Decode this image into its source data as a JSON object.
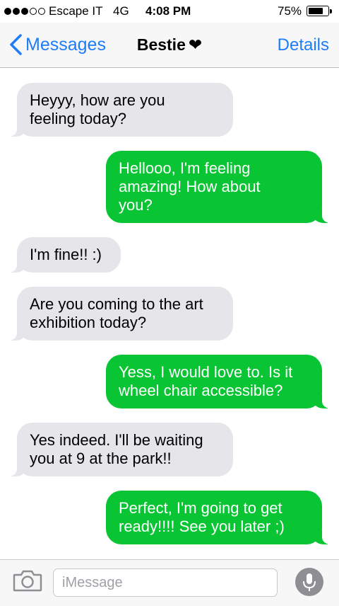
{
  "status_bar": {
    "carrier": "Escape IT",
    "network": "4G",
    "time": "4:08 PM",
    "battery_percent": "75%",
    "battery_level": 0.75,
    "signal_bars": 3,
    "signal_total": 5
  },
  "nav": {
    "back_label": "Messages",
    "contact_name": "Bestie",
    "contact_heart": "❤",
    "details_label": "Details"
  },
  "messages": [
    {
      "direction": "incoming",
      "text": "Heyyy, how are you\nfeeling today?"
    },
    {
      "direction": "outgoing",
      "text": "Hellooo, I'm feeling\namazing! How about\nyou?"
    },
    {
      "direction": "incoming",
      "text": "I'm fine!! :)"
    },
    {
      "direction": "incoming",
      "text": "Are you coming to the art\nexhibition today?"
    },
    {
      "direction": "outgoing",
      "text": "Yess, I would love to. Is it\nwheel chair accessible?"
    },
    {
      "direction": "incoming",
      "text": "Yes indeed. I'll be waiting\nyou at 9 at the park!!"
    },
    {
      "direction": "outgoing",
      "text": "Perfect, I'm going to get\nready!!!! See you later ;)"
    }
  ],
  "input": {
    "placeholder": "iMessage"
  },
  "colors": {
    "accent": "#1e7cf7",
    "outgoing_bubble": "#09c534",
    "incoming_bubble": "#e5e5ea"
  },
  "icons": {
    "back": "chevron-left-icon",
    "camera": "camera-icon",
    "mic": "microphone-icon"
  }
}
